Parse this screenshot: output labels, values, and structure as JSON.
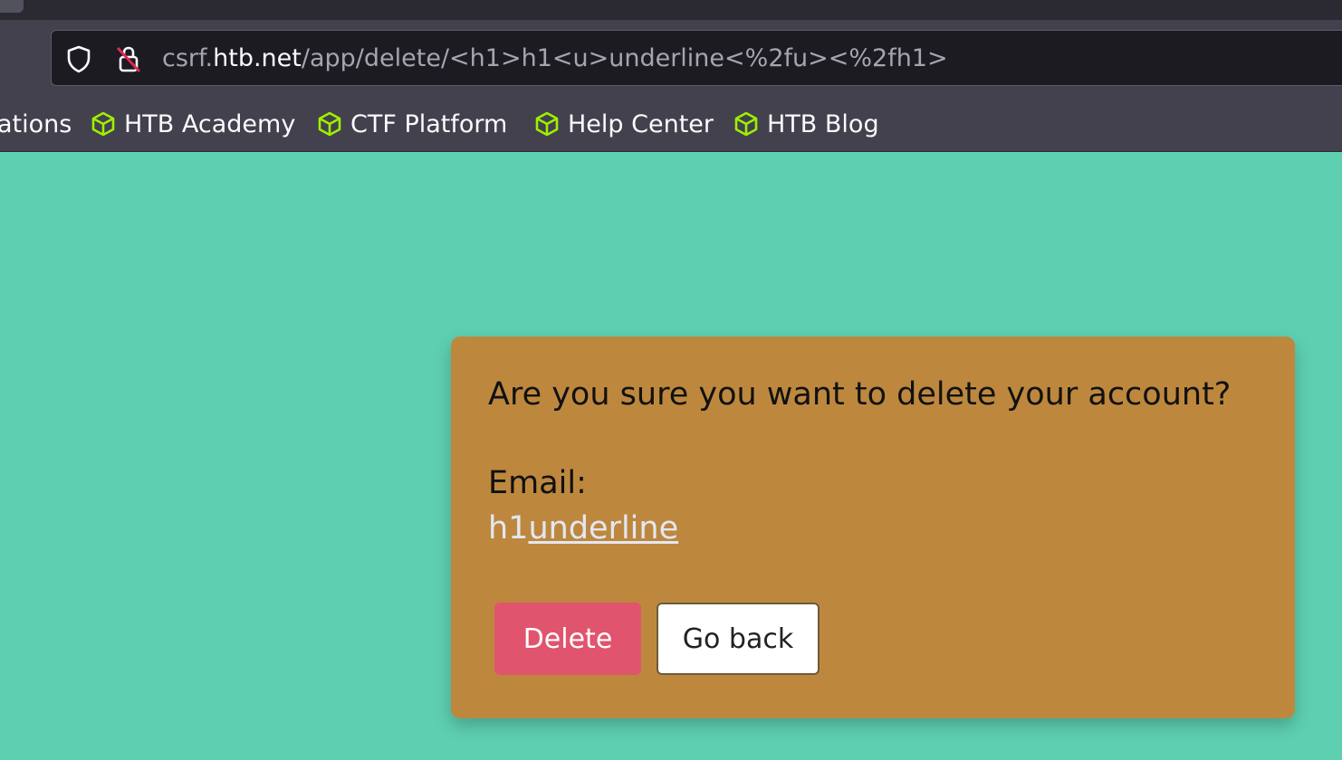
{
  "browser": {
    "url": {
      "prefix": "csrf.",
      "host": "htb.net",
      "path": "/app/delete/<h1>h1<u>underline<%2fu><%2fh1>"
    },
    "bookmarks": [
      {
        "label": "ations",
        "icon": null
      },
      {
        "label": "HTB Academy",
        "icon": "htb-cube-icon"
      },
      {
        "label": "CTF Platform",
        "icon": "htb-cube-icon"
      },
      {
        "label": "Help Center",
        "icon": "htb-cube-icon"
      },
      {
        "label": "HTB Blog",
        "icon": "htb-cube-icon"
      }
    ],
    "bookmark_icon_color": "#9fef00"
  },
  "dialog": {
    "question": "Are you sure you want to delete your account?",
    "email_label": "Email:",
    "email_value_plain": "h1",
    "email_value_underlined": "underline",
    "delete_label": "Delete",
    "back_label": "Go back"
  },
  "colors": {
    "page_background": "#5ecfb1",
    "card_background": "#bd883e",
    "delete_button": "#e0546d"
  }
}
